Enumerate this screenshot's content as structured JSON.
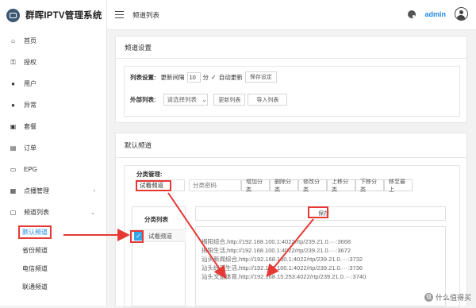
{
  "app": {
    "title": "群晖IPTV管理系统"
  },
  "topbar": {
    "breadcrumb": "频道列表",
    "user": "admin"
  },
  "sidebar": {
    "items": [
      {
        "label": "首页",
        "icon": "home-icon"
      },
      {
        "label": "授权",
        "icon": "key-icon"
      },
      {
        "label": "用户",
        "icon": "user-icon"
      },
      {
        "label": "异常",
        "icon": "user-alert-icon"
      },
      {
        "label": "套餐",
        "icon": "package-icon"
      },
      {
        "label": "订单",
        "icon": "order-icon"
      },
      {
        "label": "EPG",
        "icon": "epg-icon"
      },
      {
        "label": "点播管理",
        "icon": "vod-icon"
      },
      {
        "label": "频道列表",
        "icon": "channel-icon"
      }
    ],
    "sub_items": [
      "默认频道",
      "省份频道",
      "电信频道",
      "联通频道"
    ]
  },
  "channel_settings": {
    "title": "频道设置",
    "list_label": "列表设置:",
    "interval_label": "更新间隔",
    "interval_value": "10",
    "interval_unit": "分",
    "auto_update_label": "自动更新",
    "save_settings": "保存设定",
    "external_label": "外部列表:",
    "external_placeholder": "请选择列表",
    "update_list": "更新列表",
    "import_list": "导入列表"
  },
  "default_channel": {
    "title": "默认频道",
    "category_mgmt_label": "分类管理:",
    "category_name_value": "试看频道",
    "category_password_placeholder": "分类密码",
    "buttons": [
      "增加分类",
      "删除分类",
      "修改分类",
      "上移分类",
      "下移分类",
      "移至最上"
    ],
    "category_list_header": "分类列表",
    "category_item": "试看频道",
    "save": "保存",
    "channels": [
      "揭阳综合,http://192.168.100.1:4022/rtp/239.21.0.···:3668",
      "揭阳生活,http://192.168.100.1:4022/rtp/239.21.0.···:3672",
      "汕头新闻综合,http://192.168.100.1:4022/rtp/239.21.0.···:3732",
      "汕头经济生活,http://192.168.100.1:4022/rtp/239.21.0.···:3736",
      "汕头文旅体育,http://192.168.15.253:4022/rtp/239.21.0.···:3740"
    ]
  },
  "watermark": "什么值得买",
  "colors": {
    "accent": "#1e88e5",
    "highlight": "#e53935",
    "brand_icon": "#3d5a73"
  }
}
